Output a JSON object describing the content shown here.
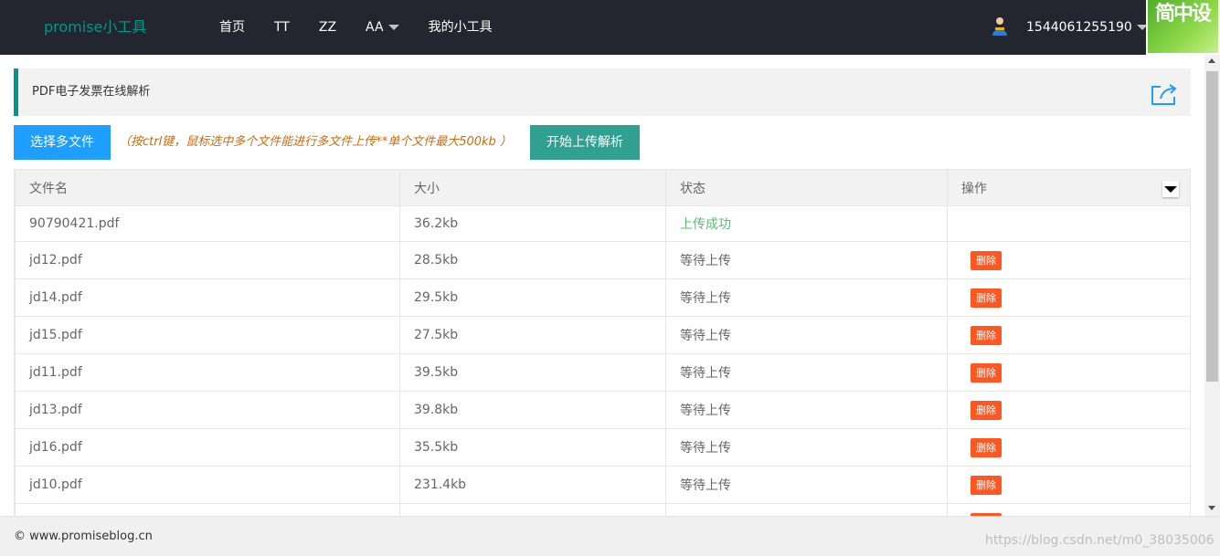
{
  "header": {
    "brand": "promise小工具",
    "nav": [
      {
        "label": "首页"
      },
      {
        "label": "TT"
      },
      {
        "label": "ZZ"
      },
      {
        "label": "AA",
        "dropdown": true
      },
      {
        "label": "我的小工具"
      }
    ],
    "username": "1544061255190",
    "corner_badge": "简中设"
  },
  "page": {
    "section_title": "PDF电子发票在线解析",
    "select_button": "选择多文件",
    "hint": "（按ctrl键，鼠标选中多个文件能进行多文件上传**单个文件最大500kb ）",
    "upload_button": "开始上传解析"
  },
  "table": {
    "headers": [
      "文件名",
      "大小",
      "状态",
      "操作"
    ],
    "delete_label": "删除",
    "rows": [
      {
        "name": "90790421.pdf",
        "size": "36.2kb",
        "status": "上传成功",
        "action": ""
      },
      {
        "name": "jd12.pdf",
        "size": "28.5kb",
        "status": "等待上传",
        "action": "删除"
      },
      {
        "name": "jd14.pdf",
        "size": "29.5kb",
        "status": "等待上传",
        "action": "删除"
      },
      {
        "name": "jd15.pdf",
        "size": "27.5kb",
        "status": "等待上传",
        "action": "删除"
      },
      {
        "name": "jd11.pdf",
        "size": "39.5kb",
        "status": "等待上传",
        "action": "删除"
      },
      {
        "name": "jd13.pdf",
        "size": "39.8kb",
        "status": "等待上传",
        "action": "删除"
      },
      {
        "name": "jd16.pdf",
        "size": "35.5kb",
        "status": "等待上传",
        "action": "删除"
      },
      {
        "name": "jd10.pdf",
        "size": "231.4kb",
        "status": "等待上传",
        "action": "删除"
      },
      {
        "name": "",
        "size": "",
        "status": "",
        "action": "删除"
      }
    ]
  },
  "footer": {
    "copyright": "© www.promiseblog.cn",
    "watermark": "https://blog.csdn.net/m0_38035006"
  },
  "colors": {
    "topbar": "#23262e",
    "brand": "#009688",
    "select_button": "#1E9FFF",
    "upload_button": "#30a090",
    "delete_button": "#FF5722",
    "success": "#5FB878"
  },
  "icons": {
    "avatar": "user-avatar-icon",
    "share": "share-icon",
    "filter": "filter-columns-icon",
    "dropdown": "caret-down-icon"
  }
}
